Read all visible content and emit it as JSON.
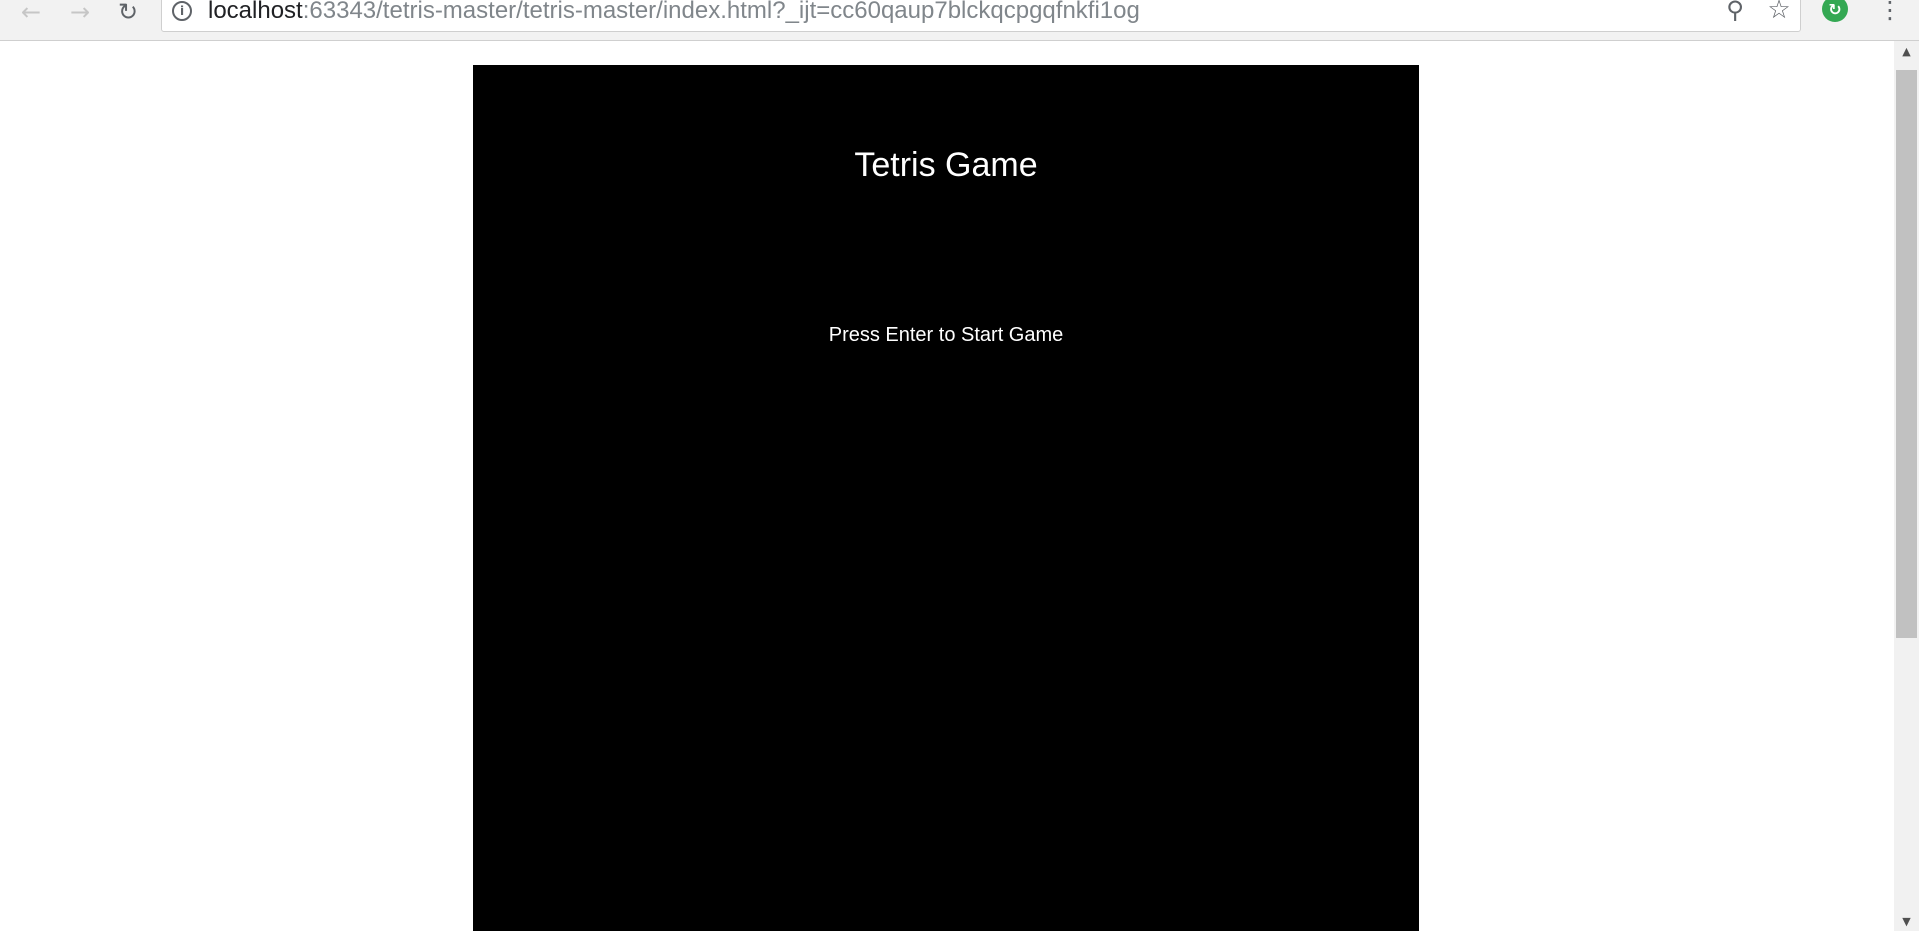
{
  "browser": {
    "back_icon": "←",
    "forward_icon": "→",
    "reload_icon": "↻",
    "info_icon": "i",
    "url_host": "localhost",
    "url_path": ":63343/tetris-master/tetris-master/index.html?_ijt=cc60qaup7blckqcpgqfnkfi1og",
    "zoom_icon": "⚲",
    "bookmark_icon": "☆",
    "extension_icon": "↻",
    "menu_icon": "⋮"
  },
  "game": {
    "title": "Tetris Game",
    "start_prompt": "Press Enter to Start Game"
  },
  "scrollbar": {
    "up_arrow": "▲",
    "down_arrow": "▼"
  },
  "colors": {
    "canvas_background": "#000000",
    "game_text": "#ffffff",
    "page_background": "#ffffff"
  }
}
